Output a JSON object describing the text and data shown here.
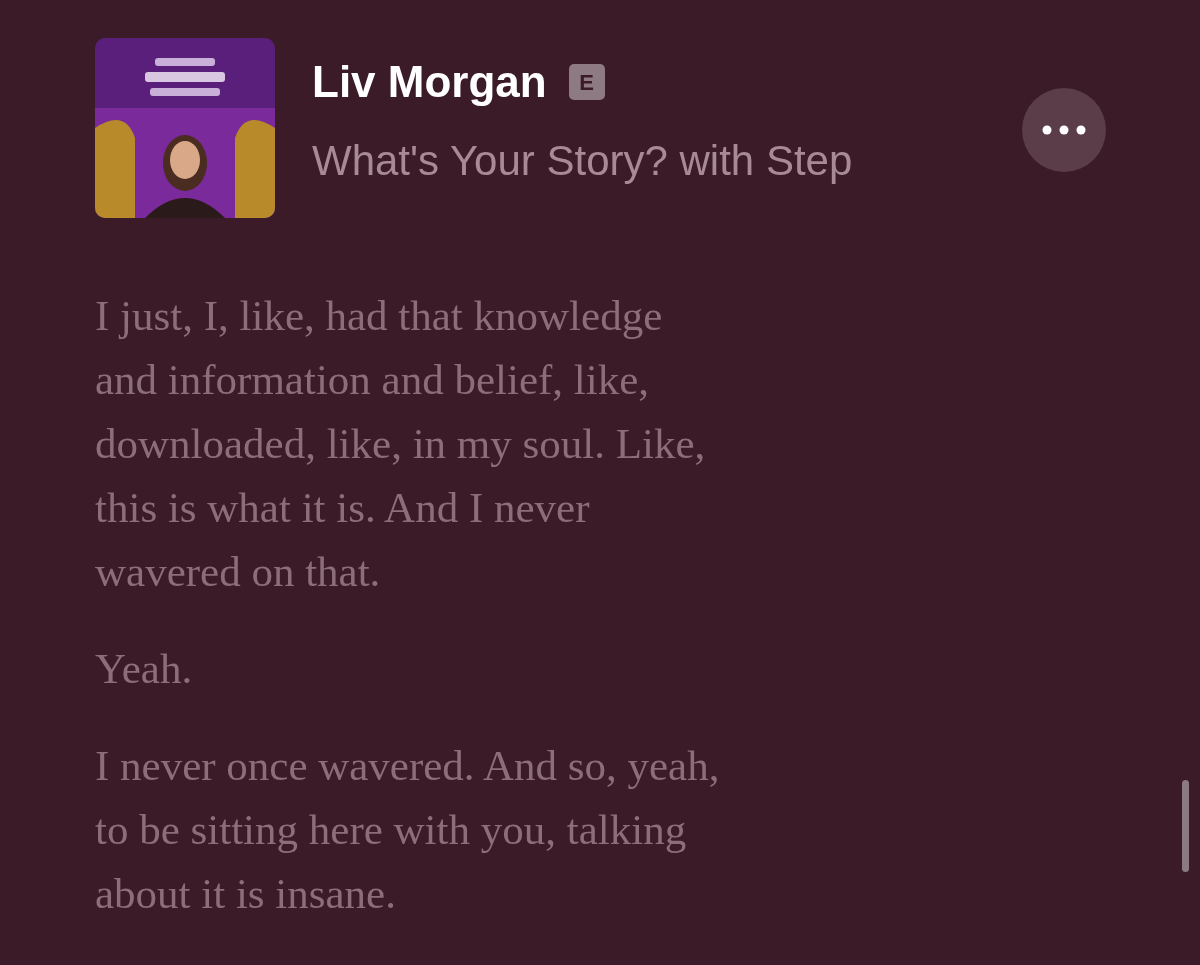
{
  "header": {
    "title": "Liv Morgan",
    "badge": "E",
    "subtitle": "What's Your Story? with Step"
  },
  "transcript": [
    {
      "lines": [
        "I just, I, like, had that knowledge",
        "and information and belief, like,",
        "downloaded, like, in my soul. Like,",
        "this is what it is. And I never",
        "wavered on that."
      ]
    },
    {
      "lines": [
        "Yeah."
      ]
    },
    {
      "lines": [
        "I never once wavered. And so, yeah,",
        "to be sitting here with you, talking",
        "about it is insane."
      ]
    }
  ]
}
